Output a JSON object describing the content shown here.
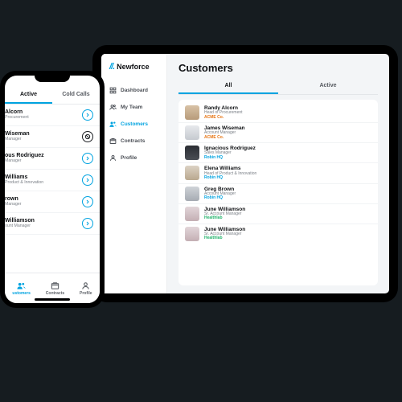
{
  "brand": {
    "name": "Newforce"
  },
  "sidebar": {
    "items": [
      {
        "label": "Dashboard"
      },
      {
        "label": "My Team"
      },
      {
        "label": "Customers"
      },
      {
        "label": "Contracts"
      },
      {
        "label": "Profile"
      }
    ]
  },
  "page": {
    "title": "Customers"
  },
  "tabs": {
    "all": "All",
    "active": "Active",
    "cold": "Cold Calls"
  },
  "companyColors": {
    "acme": "#e67514",
    "robin": "#00a3e0",
    "healthlab": "#22b26b"
  },
  "customers": [
    {
      "name": "Randy Alcorn",
      "role": "Head of Procurement",
      "company": "ACME Co.",
      "companyKey": "acme",
      "av": "av1"
    },
    {
      "name": "James Wiseman",
      "role": "Account Manager",
      "company": "ACME Co.",
      "companyKey": "acme",
      "av": "av2"
    },
    {
      "name": "Ignacious Rodriguez",
      "role": "Sales Manager",
      "company": "Robin HQ",
      "companyKey": "robin",
      "av": "av3"
    },
    {
      "name": "Elena Williams",
      "role": "Head of Product & Innovation",
      "company": "Robin HQ",
      "companyKey": "robin",
      "av": "av4"
    },
    {
      "name": "Greg Brown",
      "role": "Account Manager",
      "company": "Robin HQ",
      "companyKey": "robin",
      "av": "av5"
    },
    {
      "name": "June Williamson",
      "role": "Sr. Account Manager",
      "company": "Healthlab",
      "companyKey": "healthlab",
      "av": "av6"
    },
    {
      "name": "June Williamson",
      "role": "Sr. Account Manager",
      "company": "Healthlab",
      "companyKey": "healthlab",
      "av": "av6"
    }
  ],
  "phone": {
    "list": [
      {
        "name": "Alcorn",
        "role": "Procurement",
        "action": "arrow"
      },
      {
        "name": "Wiseman",
        "role": "Manager",
        "action": "block"
      },
      {
        "name": "ous Rodriguez",
        "role": "Manager",
        "action": "arrow"
      },
      {
        "name": "Williams",
        "role": "Product & Innovation",
        "action": "arrow"
      },
      {
        "name": "rown",
        "role": "Manager",
        "action": "arrow"
      },
      {
        "name": "Williamson",
        "role": "ount Manager",
        "action": "arrow"
      }
    ],
    "bottomNav": [
      {
        "label": "ustomers"
      },
      {
        "label": "Contracts"
      },
      {
        "label": "Profile"
      }
    ]
  }
}
